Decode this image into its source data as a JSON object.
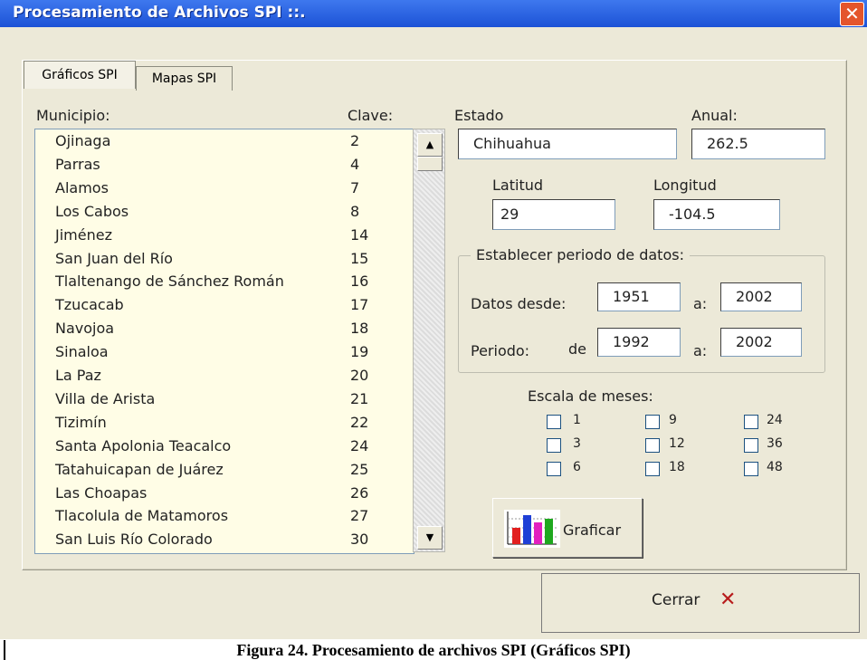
{
  "window": {
    "title": "Procesamiento de Archivos SPI ::.",
    "close_label": "✕"
  },
  "tabs": [
    {
      "label": "Gráficos SPI",
      "active": true
    },
    {
      "label": "Mapas SPI",
      "active": false
    }
  ],
  "list": {
    "header_name": "Municipio:",
    "header_key": "Clave:",
    "items": [
      {
        "name": "Ojinaga",
        "key": "2"
      },
      {
        "name": "Parras",
        "key": "4"
      },
      {
        "name": "Alamos",
        "key": "7"
      },
      {
        "name": "Los Cabos",
        "key": "8"
      },
      {
        "name": "Jiménez",
        "key": "14"
      },
      {
        "name": "San Juan del Río",
        "key": "15"
      },
      {
        "name": "Tlaltenango de Sánchez Román",
        "key": "16"
      },
      {
        "name": "Tzucacab",
        "key": "17"
      },
      {
        "name": "Navojoa",
        "key": "18"
      },
      {
        "name": "Sinaloa",
        "key": "19"
      },
      {
        "name": "La Paz",
        "key": "20"
      },
      {
        "name": "Villa de Arista",
        "key": "21"
      },
      {
        "name": "Tizimín",
        "key": "22"
      },
      {
        "name": "Santa Apolonia Teacalco",
        "key": "24"
      },
      {
        "name": "Tatahuicapan de Juárez",
        "key": "25"
      },
      {
        "name": "Las Choapas",
        "key": "26"
      },
      {
        "name": "Tlacolula de Matamoros",
        "key": "27"
      },
      {
        "name": "San Luis Río Colorado",
        "key": "30"
      }
    ]
  },
  "form": {
    "estado_label": "Estado",
    "estado_value": "Chihuahua",
    "anual_label": "Anual:",
    "anual_value": "262.5",
    "latitud_label": "Latitud",
    "latitud_value": "29",
    "longitud_label": "Longitud",
    "longitud_value": "-104.5"
  },
  "periodo": {
    "group_title": "Establecer periodo de datos:",
    "desde_label": "Datos desde:",
    "desde_value": "1951",
    "a_label": "a:",
    "desde_end_value": "2002",
    "periodo_label": "Periodo:",
    "de_label": "de",
    "periodo_start_value": "1992",
    "periodo_end_value": "2002"
  },
  "escala": {
    "title": "Escala de meses:",
    "options": [
      "1",
      "3",
      "6",
      "9",
      "12",
      "18",
      "24",
      "36",
      "48"
    ]
  },
  "buttons": {
    "graficar_label": "Graficar",
    "cerrar_label": "Cerrar",
    "cerrar_icon": "✕"
  },
  "caption": "Figura 24. Procesamiento de archivos SPI (Gráficos SPI)",
  "icons": [
    "close-icon",
    "chart-icon",
    "cerrar-x-icon",
    "scroll-up-icon",
    "scroll-down-icon"
  ]
}
